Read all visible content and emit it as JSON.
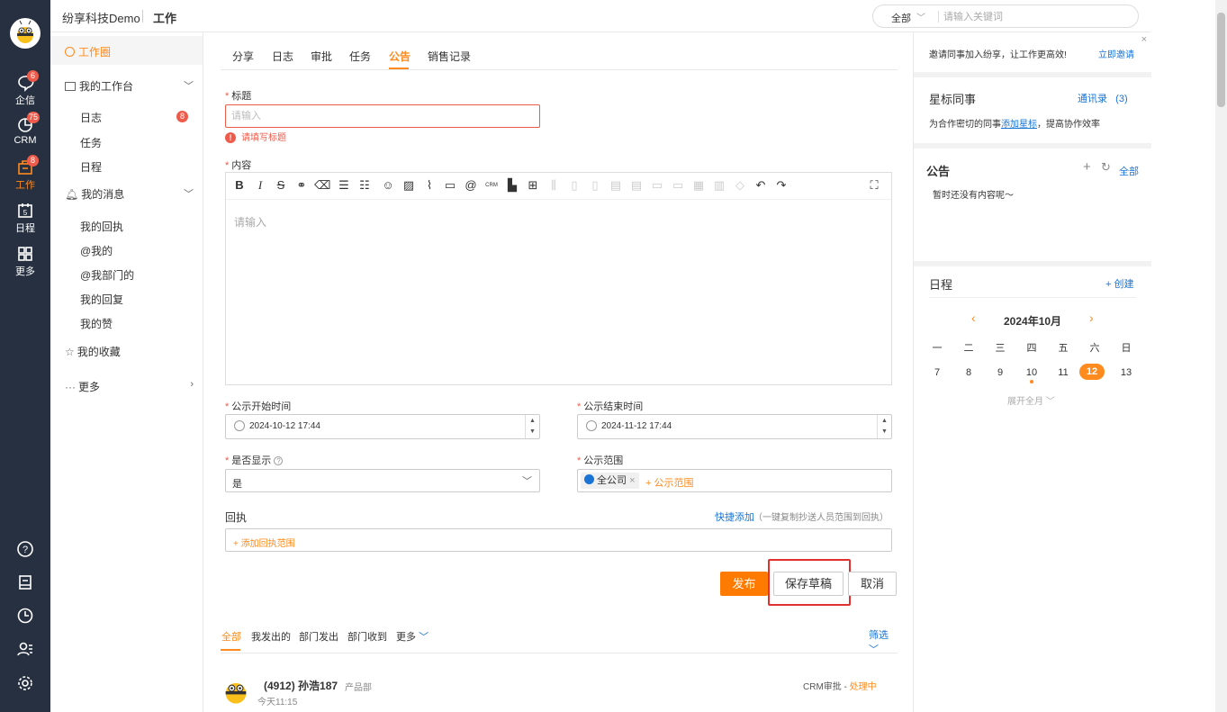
{
  "rail": {
    "items": [
      {
        "label": "企信",
        "badge": "6"
      },
      {
        "label": "CRM",
        "badge": "75"
      },
      {
        "label": "工作",
        "badge": "8"
      },
      {
        "label": "日程",
        "badge": ""
      },
      {
        "label": "更多",
        "badge": ""
      }
    ],
    "calendar_day": "5",
    "bottom_icons": [
      "help-icon",
      "note-icon",
      "history-icon",
      "contacts-icon",
      "settings-icon"
    ]
  },
  "topbar": {
    "brand": "纷享科技Demo",
    "page": "工作",
    "search_scope": "全部",
    "search_placeholder": "请输入关键词"
  },
  "sidebar": {
    "home": "工作圈",
    "workbench": "我的工作台",
    "workbench_items": [
      {
        "label": "日志",
        "badge": "8"
      },
      {
        "label": "任务",
        "badge": ""
      },
      {
        "label": "日程",
        "badge": ""
      }
    ],
    "messages": "我的消息",
    "message_items": [
      "我的回执",
      "@我的",
      "@我部门的",
      "我的回复",
      "我的赞"
    ],
    "favorites": "我的收藏",
    "more": "更多"
  },
  "tabs": [
    "分享",
    "日志",
    "审批",
    "任务",
    "公告",
    "销售记录"
  ],
  "active_tab": "公告",
  "form": {
    "title_label": "标题",
    "title_placeholder": "请输入",
    "title_error": "请填写标题",
    "content_label": "内容",
    "content_placeholder": "请输入",
    "start_label": "公示开始时间",
    "start_value": "2024-10-12 17:44",
    "end_label": "公示结束时间",
    "end_value": "2024-11-12 17:44",
    "display_label": "是否显示",
    "display_value": "是",
    "scope_label": "公示范围",
    "scope_tag": "全公司",
    "scope_add": "+ 公示范围",
    "receipt_label": "回执",
    "quick_add": "快捷添加",
    "quick_add_hint": "（一键复制抄送人员范围到回执）",
    "receipt_add": "+ 添加回执范围",
    "publish": "发布",
    "save_draft": "保存草稿",
    "cancel": "取消"
  },
  "feed": {
    "tabs": [
      "全部",
      "我发出的",
      "部门发出",
      "部门收到",
      "更多"
    ],
    "filter": "筛选",
    "post_author": "(4912) 孙浩187",
    "post_dept": "产品部",
    "post_time": "今天11:15",
    "post_type": "CRM审批 - ",
    "post_status": "处理中"
  },
  "right": {
    "invite_text": "邀请同事加入纷享，让工作更高效!",
    "invite_link": "立即邀请",
    "star_title": "星标同事",
    "contacts_link": "通讯录",
    "contacts_count": "(3)",
    "star_desc_pre": "为合作密切的同事",
    "star_desc_link": "添加星标",
    "star_desc_post": "，提高协作效率",
    "notice_title": "公告",
    "notice_all": "全部",
    "notice_empty": "暂时还没有内容呢～",
    "schedule_title": "日程",
    "schedule_create": "+ 创建",
    "month": "2024年10月",
    "weekdays": [
      "一",
      "二",
      "三",
      "四",
      "五",
      "六",
      "日"
    ],
    "days": [
      "7",
      "8",
      "9",
      "10",
      "11",
      "12",
      "13"
    ],
    "today": "12",
    "expand": "展开全月"
  },
  "accent_color": "#ff8a1d",
  "error_color": "#ef5b4b",
  "link_color": "#1a74d6"
}
